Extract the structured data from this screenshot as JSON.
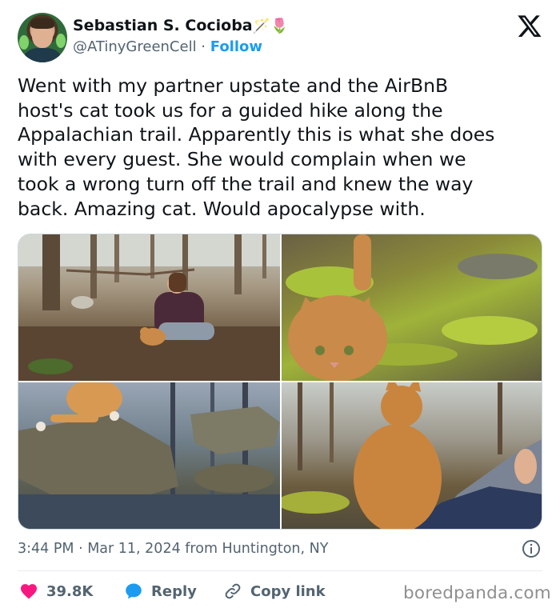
{
  "author": {
    "display_name": "Sebastian S. Cocioba",
    "name_emojis": "🪄🌷",
    "handle": "@ATinyGreenCell",
    "separator": " · ",
    "follow_label": "Follow"
  },
  "tweet": {
    "text": "Went with my partner upstate and the AirBnB\nhost's cat took us for a guided hike along the\nAppalachian trail. Apparently this is what she does\nwith every guest. She would complain when we\ntook a wrong turn off the trail and knew the way\nback. Amazing cat. Would apocalypse with."
  },
  "meta": {
    "timestamp": "3:44 PM · Mar 11, 2024 from Huntington, NY"
  },
  "actions": {
    "likes": "39.8K",
    "reply_label": "Reply",
    "copy_label": "Copy link"
  },
  "watermark": "boredpanda.com",
  "colors": {
    "accent": "#1d9bf0",
    "like": "#f91880",
    "muted": "#536471"
  },
  "icons": [
    "x-logo-icon",
    "info-icon",
    "heart-icon",
    "reply-bubble-icon",
    "link-icon"
  ]
}
